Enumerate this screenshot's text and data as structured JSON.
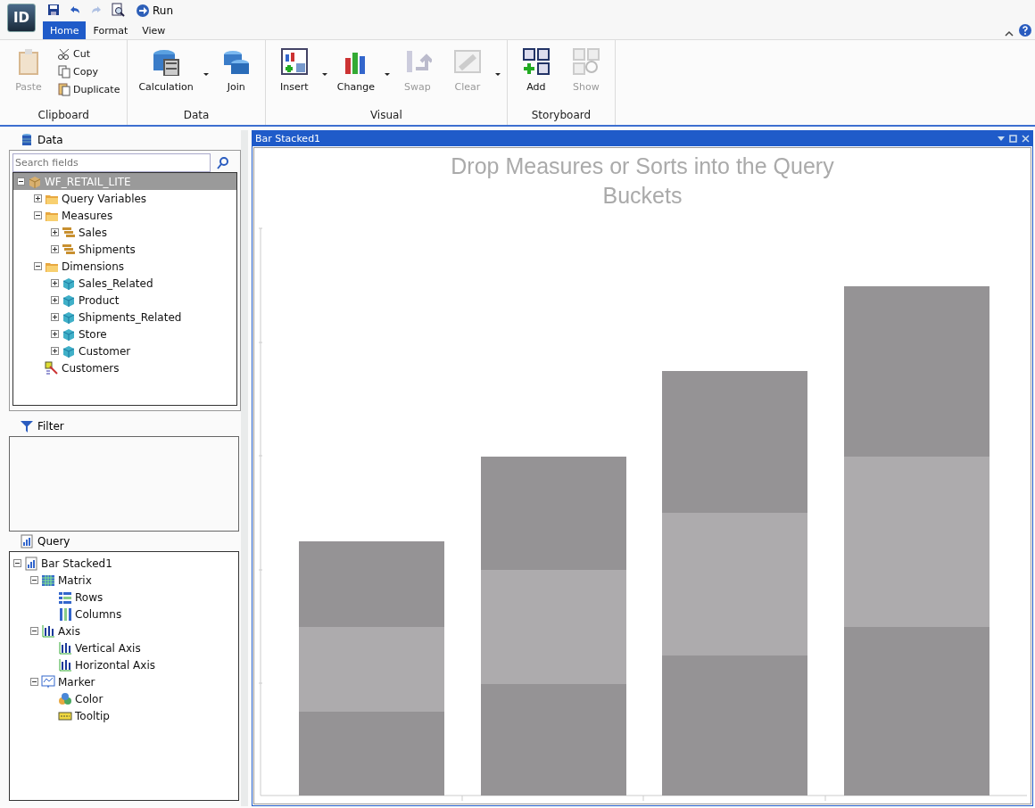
{
  "app": {
    "logo": "ID"
  },
  "quick_access": [
    {
      "kind": "save",
      "disabled": false
    },
    {
      "kind": "undo",
      "disabled": false
    },
    {
      "kind": "redo",
      "disabled": true
    },
    {
      "kind": "preview",
      "disabled": false
    }
  ],
  "run_button": {
    "label": "Run"
  },
  "tabs": [
    {
      "label": "Home",
      "selected": true
    },
    {
      "label": "Format",
      "selected": false
    },
    {
      "label": "View",
      "selected": false
    }
  ],
  "ribbon": [
    {
      "title": "Clipboard",
      "buttons": [
        {
          "kind": "paste",
          "label": "Paste",
          "disabled": true,
          "dropdown": false
        }
      ],
      "small_buttons": [
        {
          "kind": "cut",
          "label": "Cut",
          "disabled": false
        },
        {
          "kind": "copy",
          "label": "Copy",
          "disabled": false
        },
        {
          "kind": "duplicate",
          "label": "Duplicate",
          "disabled": false
        }
      ]
    },
    {
      "title": "Data",
      "buttons": [
        {
          "kind": "calculation",
          "label": "Calculation",
          "disabled": false,
          "dropdown": true
        },
        {
          "kind": "join",
          "label": "Join",
          "disabled": false,
          "dropdown": false
        }
      ]
    },
    {
      "title": "Visual",
      "buttons": [
        {
          "kind": "insert",
          "label": "Insert",
          "disabled": false,
          "dropdown": true
        },
        {
          "kind": "change",
          "label": "Change",
          "disabled": false,
          "dropdown": true
        },
        {
          "kind": "swap",
          "label": "Swap",
          "disabled": true,
          "dropdown": false
        },
        {
          "kind": "clear",
          "label": "Clear",
          "disabled": true,
          "dropdown": true
        }
      ]
    },
    {
      "title": "Storyboard",
      "buttons": [
        {
          "kind": "add",
          "label": "Add",
          "disabled": false,
          "dropdown": false
        },
        {
          "kind": "show",
          "label": "Show",
          "disabled": true,
          "dropdown": false
        }
      ]
    }
  ],
  "data_panel": {
    "title": "Data",
    "search": {
      "placeholder": "Search fields"
    },
    "tree": [
      {
        "label": "WF_RETAIL_LITE",
        "kind": "cube",
        "selected": true,
        "expanded": true,
        "children": [
          {
            "label": "Query Variables",
            "kind": "folder",
            "selected": false,
            "expanded": false
          },
          {
            "label": "Measures",
            "kind": "folder",
            "selected": false,
            "expanded": true,
            "children": [
              {
                "label": "Sales",
                "kind": "measure",
                "selected": false,
                "expanded": false
              },
              {
                "label": "Shipments",
                "kind": "measure",
                "selected": false,
                "expanded": false
              }
            ]
          },
          {
            "label": "Dimensions",
            "kind": "folder",
            "selected": false,
            "expanded": true,
            "children": [
              {
                "label": "Sales_Related",
                "kind": "dimension",
                "selected": false,
                "expanded": false
              },
              {
                "label": "Product",
                "kind": "dimension",
                "selected": false,
                "expanded": false
              },
              {
                "label": "Shipments_Related",
                "kind": "dimension",
                "selected": false,
                "expanded": false
              },
              {
                "label": "Store",
                "kind": "dimension",
                "selected": false,
                "expanded": false
              },
              {
                "label": "Customer",
                "kind": "dimension",
                "selected": false,
                "expanded": false
              }
            ]
          },
          {
            "label": "Customers",
            "kind": "define",
            "selected": false
          }
        ]
      }
    ]
  },
  "filter_panel": {
    "title": "Filter"
  },
  "query_panel": {
    "title": "Query",
    "tree": [
      {
        "label": "Bar Stacked1",
        "kind": "chart",
        "expanded": true,
        "children": [
          {
            "label": "Matrix",
            "kind": "matrix",
            "expanded": true,
            "children": [
              {
                "label": "Rows",
                "kind": "rows"
              },
              {
                "label": "Columns",
                "kind": "columns"
              }
            ]
          },
          {
            "label": "Axis",
            "kind": "axis",
            "expanded": true,
            "children": [
              {
                "label": "Vertical Axis",
                "kind": "axis"
              },
              {
                "label": "Horizontal Axis",
                "kind": "axis"
              }
            ]
          },
          {
            "label": "Marker",
            "kind": "marker",
            "expanded": true,
            "children": [
              {
                "label": "Color",
                "kind": "color"
              },
              {
                "label": "Tooltip",
                "kind": "tooltip"
              }
            ]
          }
        ]
      }
    ]
  },
  "canvas": {
    "title": "Bar Stacked1",
    "message": "Drop Measures or Sorts into the Query Buckets"
  }
}
